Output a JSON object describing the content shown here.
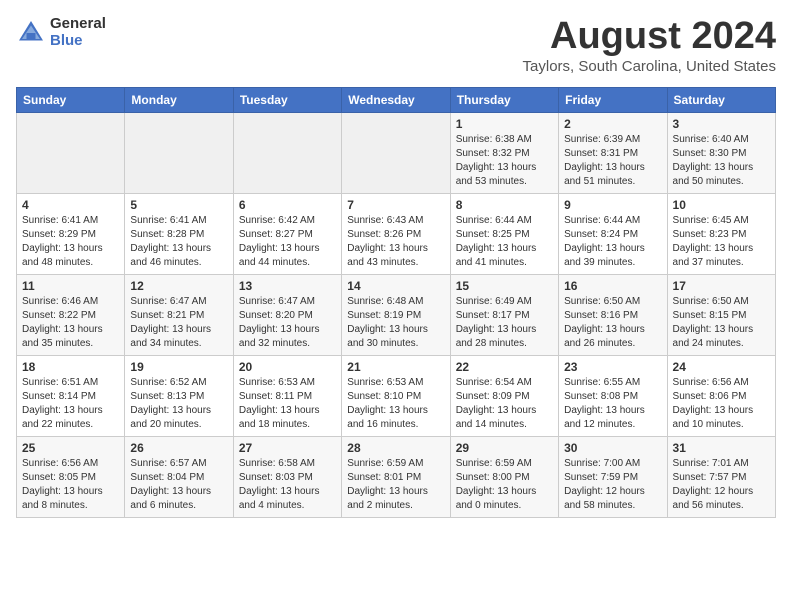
{
  "header": {
    "logo_general": "General",
    "logo_blue": "Blue",
    "month_title": "August 2024",
    "location": "Taylors, South Carolina, United States"
  },
  "days_of_week": [
    "Sunday",
    "Monday",
    "Tuesday",
    "Wednesday",
    "Thursday",
    "Friday",
    "Saturday"
  ],
  "weeks": [
    [
      {
        "num": "",
        "info": ""
      },
      {
        "num": "",
        "info": ""
      },
      {
        "num": "",
        "info": ""
      },
      {
        "num": "",
        "info": ""
      },
      {
        "num": "1",
        "info": "Sunrise: 6:38 AM\nSunset: 8:32 PM\nDaylight: 13 hours\nand 53 minutes."
      },
      {
        "num": "2",
        "info": "Sunrise: 6:39 AM\nSunset: 8:31 PM\nDaylight: 13 hours\nand 51 minutes."
      },
      {
        "num": "3",
        "info": "Sunrise: 6:40 AM\nSunset: 8:30 PM\nDaylight: 13 hours\nand 50 minutes."
      }
    ],
    [
      {
        "num": "4",
        "info": "Sunrise: 6:41 AM\nSunset: 8:29 PM\nDaylight: 13 hours\nand 48 minutes."
      },
      {
        "num": "5",
        "info": "Sunrise: 6:41 AM\nSunset: 8:28 PM\nDaylight: 13 hours\nand 46 minutes."
      },
      {
        "num": "6",
        "info": "Sunrise: 6:42 AM\nSunset: 8:27 PM\nDaylight: 13 hours\nand 44 minutes."
      },
      {
        "num": "7",
        "info": "Sunrise: 6:43 AM\nSunset: 8:26 PM\nDaylight: 13 hours\nand 43 minutes."
      },
      {
        "num": "8",
        "info": "Sunrise: 6:44 AM\nSunset: 8:25 PM\nDaylight: 13 hours\nand 41 minutes."
      },
      {
        "num": "9",
        "info": "Sunrise: 6:44 AM\nSunset: 8:24 PM\nDaylight: 13 hours\nand 39 minutes."
      },
      {
        "num": "10",
        "info": "Sunrise: 6:45 AM\nSunset: 8:23 PM\nDaylight: 13 hours\nand 37 minutes."
      }
    ],
    [
      {
        "num": "11",
        "info": "Sunrise: 6:46 AM\nSunset: 8:22 PM\nDaylight: 13 hours\nand 35 minutes."
      },
      {
        "num": "12",
        "info": "Sunrise: 6:47 AM\nSunset: 8:21 PM\nDaylight: 13 hours\nand 34 minutes."
      },
      {
        "num": "13",
        "info": "Sunrise: 6:47 AM\nSunset: 8:20 PM\nDaylight: 13 hours\nand 32 minutes."
      },
      {
        "num": "14",
        "info": "Sunrise: 6:48 AM\nSunset: 8:19 PM\nDaylight: 13 hours\nand 30 minutes."
      },
      {
        "num": "15",
        "info": "Sunrise: 6:49 AM\nSunset: 8:17 PM\nDaylight: 13 hours\nand 28 minutes."
      },
      {
        "num": "16",
        "info": "Sunrise: 6:50 AM\nSunset: 8:16 PM\nDaylight: 13 hours\nand 26 minutes."
      },
      {
        "num": "17",
        "info": "Sunrise: 6:50 AM\nSunset: 8:15 PM\nDaylight: 13 hours\nand 24 minutes."
      }
    ],
    [
      {
        "num": "18",
        "info": "Sunrise: 6:51 AM\nSunset: 8:14 PM\nDaylight: 13 hours\nand 22 minutes."
      },
      {
        "num": "19",
        "info": "Sunrise: 6:52 AM\nSunset: 8:13 PM\nDaylight: 13 hours\nand 20 minutes."
      },
      {
        "num": "20",
        "info": "Sunrise: 6:53 AM\nSunset: 8:11 PM\nDaylight: 13 hours\nand 18 minutes."
      },
      {
        "num": "21",
        "info": "Sunrise: 6:53 AM\nSunset: 8:10 PM\nDaylight: 13 hours\nand 16 minutes."
      },
      {
        "num": "22",
        "info": "Sunrise: 6:54 AM\nSunset: 8:09 PM\nDaylight: 13 hours\nand 14 minutes."
      },
      {
        "num": "23",
        "info": "Sunrise: 6:55 AM\nSunset: 8:08 PM\nDaylight: 13 hours\nand 12 minutes."
      },
      {
        "num": "24",
        "info": "Sunrise: 6:56 AM\nSunset: 8:06 PM\nDaylight: 13 hours\nand 10 minutes."
      }
    ],
    [
      {
        "num": "25",
        "info": "Sunrise: 6:56 AM\nSunset: 8:05 PM\nDaylight: 13 hours\nand 8 minutes."
      },
      {
        "num": "26",
        "info": "Sunrise: 6:57 AM\nSunset: 8:04 PM\nDaylight: 13 hours\nand 6 minutes."
      },
      {
        "num": "27",
        "info": "Sunrise: 6:58 AM\nSunset: 8:03 PM\nDaylight: 13 hours\nand 4 minutes."
      },
      {
        "num": "28",
        "info": "Sunrise: 6:59 AM\nSunset: 8:01 PM\nDaylight: 13 hours\nand 2 minutes."
      },
      {
        "num": "29",
        "info": "Sunrise: 6:59 AM\nSunset: 8:00 PM\nDaylight: 13 hours\nand 0 minutes."
      },
      {
        "num": "30",
        "info": "Sunrise: 7:00 AM\nSunset: 7:59 PM\nDaylight: 12 hours\nand 58 minutes."
      },
      {
        "num": "31",
        "info": "Sunrise: 7:01 AM\nSunset: 7:57 PM\nDaylight: 12 hours\nand 56 minutes."
      }
    ]
  ]
}
